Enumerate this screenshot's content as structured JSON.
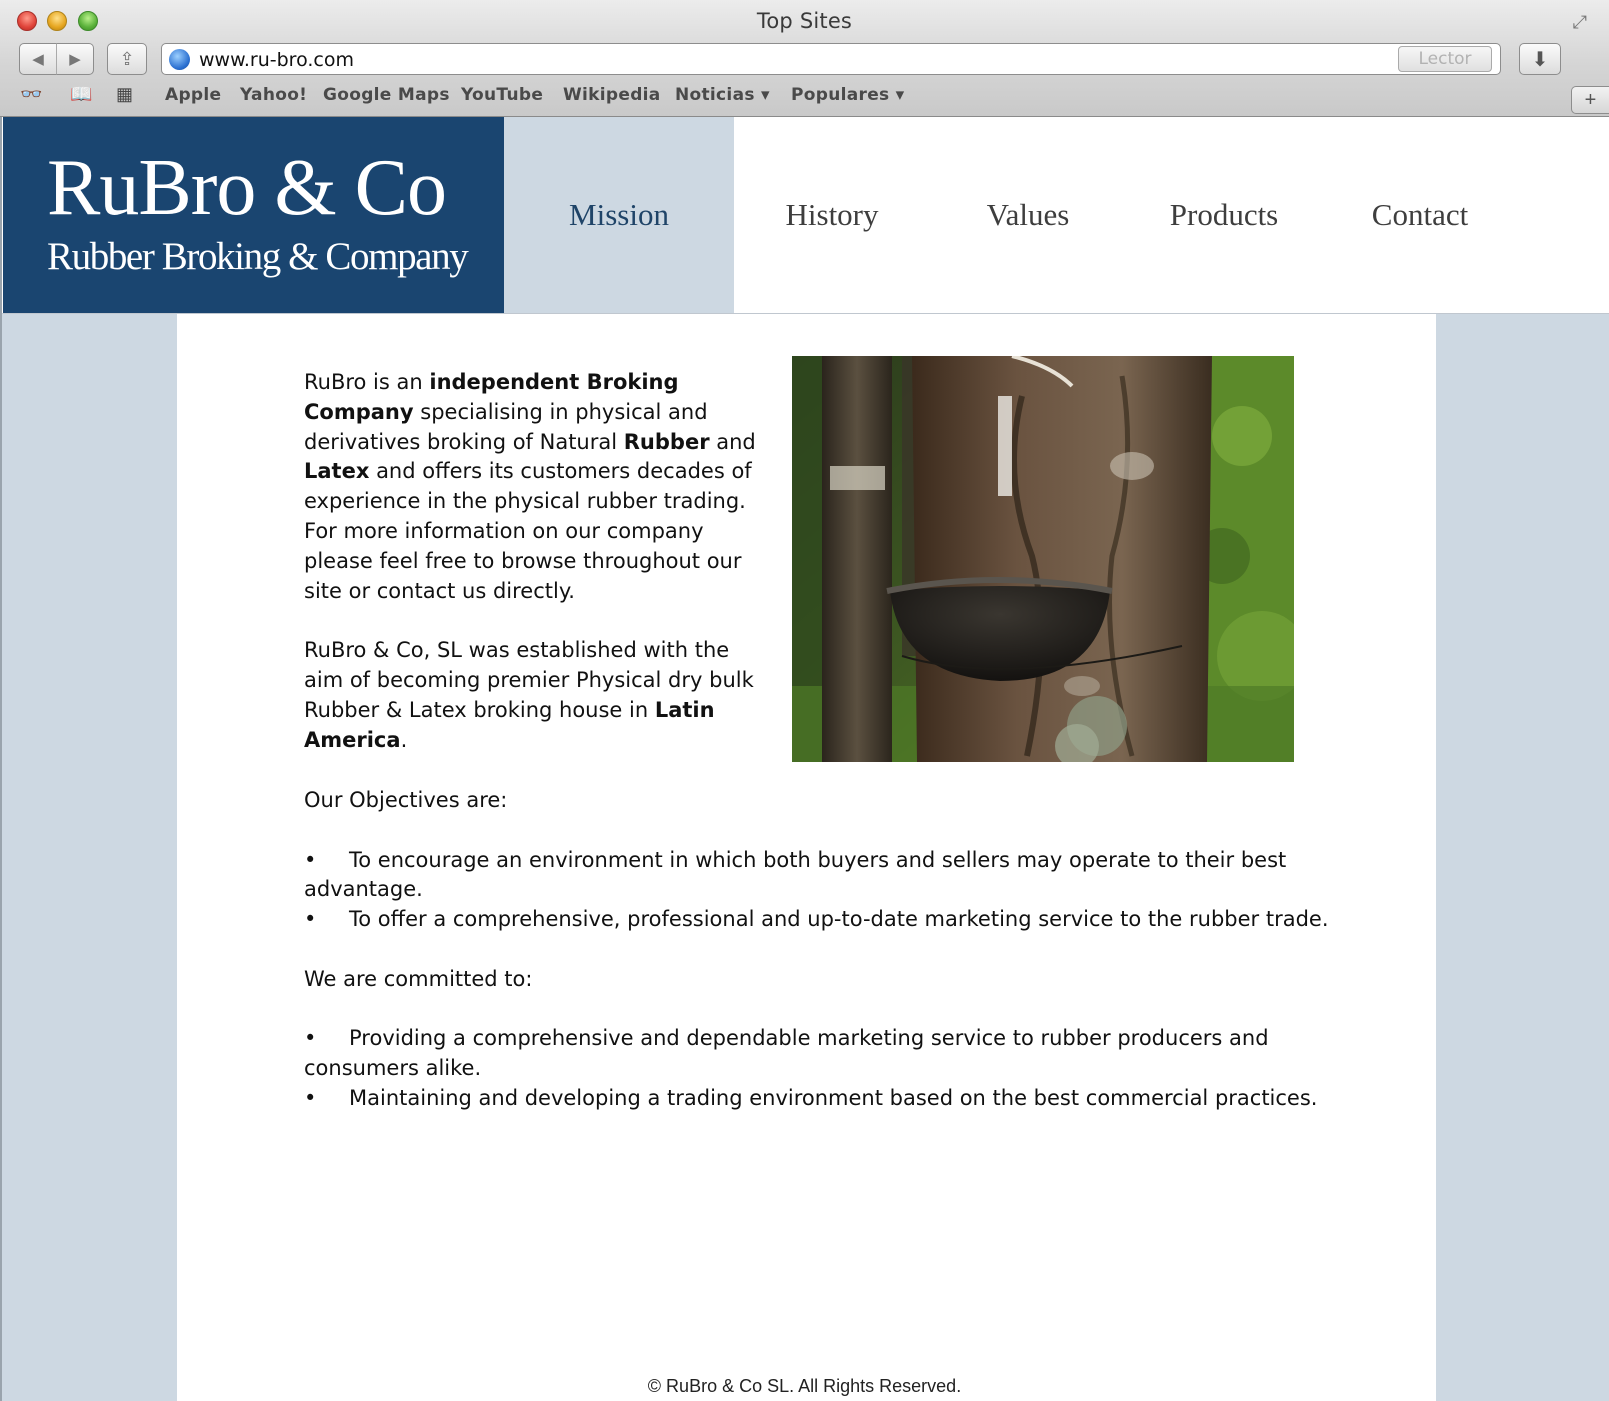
{
  "window": {
    "title": "Top Sites",
    "url": "www.ru-bro.com",
    "reader_label": "Lector"
  },
  "bookmarks": [
    {
      "label": "Apple"
    },
    {
      "label": "Yahoo!"
    },
    {
      "label": "Google Maps"
    },
    {
      "label": "YouTube"
    },
    {
      "label": "Wikipedia"
    },
    {
      "label": "Noticias ▾"
    },
    {
      "label": "Populares ▾"
    }
  ],
  "logo": {
    "main": "RuBro & Co",
    "sub": "Rubber Broking & Company"
  },
  "nav": [
    {
      "label": "Mission",
      "active": true
    },
    {
      "label": "History"
    },
    {
      "label": "Values"
    },
    {
      "label": "Products"
    },
    {
      "label": "Contact"
    }
  ],
  "intro": {
    "p1": [
      {
        "text": "RuBro is an "
      },
      {
        "text": "independent Broking Company",
        "bold": true
      },
      {
        "text": " specialising in physical and derivatives broking of Natural "
      },
      {
        "text": "Rubber",
        "bold": true
      },
      {
        "text": " and "
      },
      {
        "text": "Latex",
        "bold": true
      },
      {
        "text": " and offers its customers decades of experience in the physical rubber trading. For more information on our company please feel free to browse throughout our site or contact us directly."
      }
    ],
    "p2": [
      {
        "text": "RuBro & Co, SL was established with the aim of becoming premier Physical dry bulk Rubber & Latex broking house in "
      },
      {
        "text": "Latin America",
        "bold": true
      },
      {
        "text": "."
      }
    ]
  },
  "objectives": {
    "heading": "Our Objectives are:",
    "items": [
      "To encourage an environment in which both buyers and sellers may operate to their best advantage.",
      "To offer a comprehensive, professional and up-to-date marketing service to the rubber trade."
    ]
  },
  "commitments": {
    "heading": "We are committed to:",
    "items": [
      "Providing a comprehensive and dependable marketing service to rubber producers and consumers alike.",
      "Maintaining and developing a trading environment based on the best commercial practices."
    ]
  },
  "bullet_char": "•",
  "footer": "© RuBro & Co SL. All Rights Reserved.",
  "colors": {
    "brand_navy": "#1a4570",
    "nav_active_bg": "#cdd8e2",
    "side_panel": "#cdd8e2"
  },
  "icons": [
    "back-arrow-icon",
    "forward-arrow-icon",
    "share-icon",
    "globe-icon",
    "download-icon",
    "reading-list-icon",
    "bookmarks-book-icon",
    "top-sites-grid-icon",
    "fullscreen-icon",
    "add-tab-icon"
  ]
}
